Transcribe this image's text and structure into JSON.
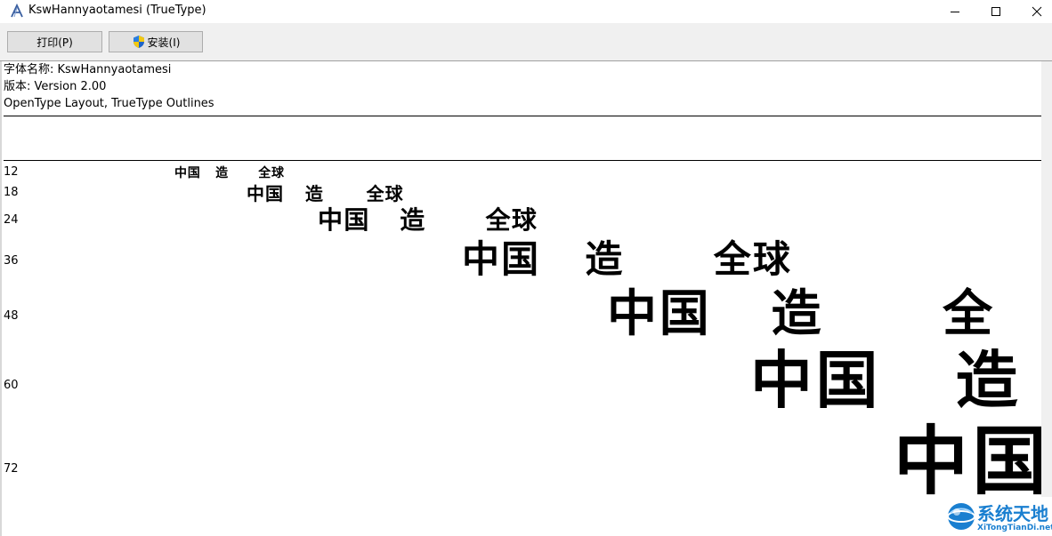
{
  "window": {
    "title": "KswHannyaotamesi (TrueType)"
  },
  "toolbar": {
    "print_label": "打印(P)",
    "install_label": "安装(I)"
  },
  "font_info": {
    "name_line": "字体名称: KswHannyaotamesi",
    "version_line": "版本: Version 2.00",
    "layout_line": "OpenType Layout, TrueType Outlines"
  },
  "samples": [
    {
      "size": "12",
      "text": "中国   造      全球"
    },
    {
      "size": "18",
      "text": "中国   造      全球"
    },
    {
      "size": "24",
      "text": "中国   造      全球"
    },
    {
      "size": "36",
      "text": "中国   造      全球"
    },
    {
      "size": "48",
      "text": "中国   造      全"
    },
    {
      "size": "60",
      "text": "中国   造"
    },
    {
      "size": "72",
      "text": "中国"
    }
  ],
  "watermark": {
    "title": "系统天地",
    "subtitle": "XiTongTianDi.net"
  }
}
